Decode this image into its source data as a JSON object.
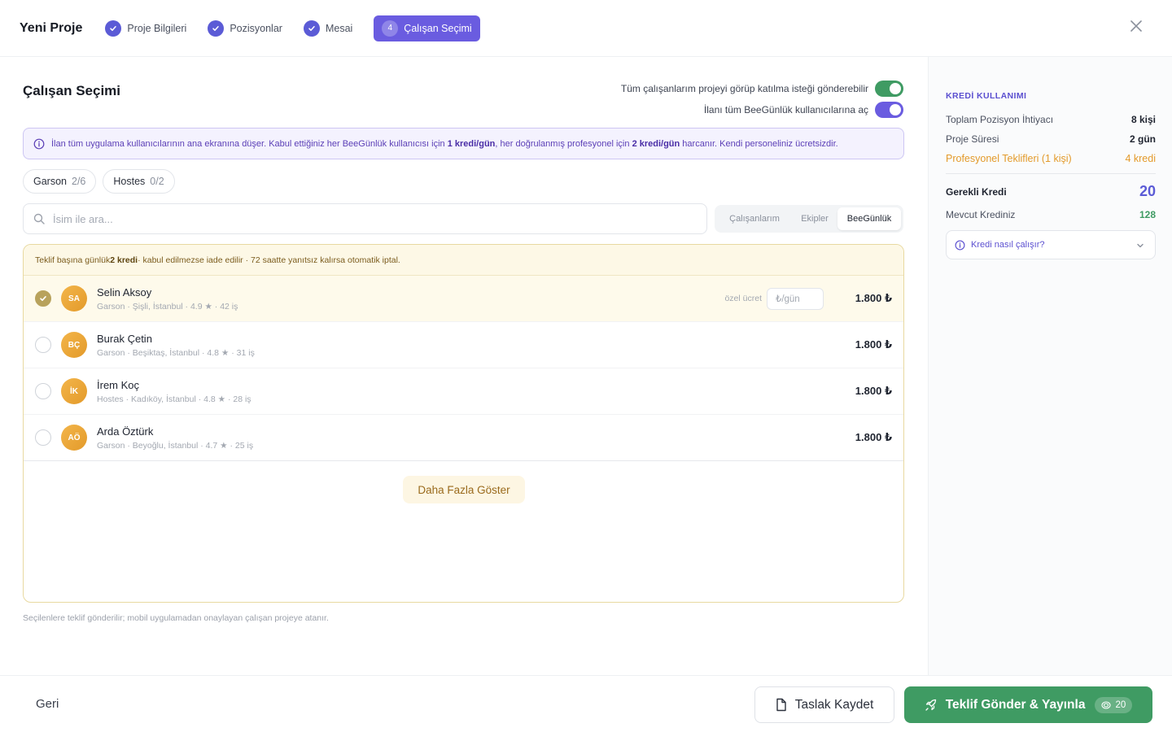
{
  "header": {
    "app_title": "Yeni Proje",
    "steps": [
      {
        "label": "Proje Bilgileri"
      },
      {
        "label": "Pozisyonlar"
      },
      {
        "label": "Mesai"
      }
    ],
    "active_step": {
      "num": "4",
      "label": "Çalışan Seçimi"
    }
  },
  "main": {
    "title": "Çalışan Seçimi",
    "toggles": [
      {
        "label": "Tüm çalışanlarım projeyi görüp katılma isteği gönderebilir",
        "on": true,
        "color": "#3f9b63"
      },
      {
        "label": "İlanı tüm BeeGünlük kullanıcılarına aç",
        "on": true,
        "color": "#6a5ce0"
      }
    ],
    "info": {
      "t1": "İlan tüm uygulama kullanıcılarının ana ekranına düşer. Kabul ettiğiniz her BeeGünlük kullanıcısı için ",
      "b1": "1 kredi/gün",
      "t2": ", her doğrulanmış profesyonel için ",
      "b2": "2 kredi/gün",
      "t3": " harcanır. Kendi personeliniz ücretsizdir."
    },
    "chips": [
      {
        "label": "Garson",
        "count": "2/6"
      },
      {
        "label": "Hostes",
        "count": "0/2"
      }
    ],
    "search_placeholder": "İsim ile ara...",
    "segments": [
      "Çalışanlarım",
      "Ekipler",
      "BeeGünlük"
    ],
    "active_segment": "BeeGünlük",
    "notice": {
      "t1": "Teklif başına günlük ",
      "b1": "2 kredi",
      "t2": " · kabul edilmezse iade edilir · 72 saatte yanıtsız kalırsa otomatik iptal."
    },
    "custom_price_label": "özel ücret",
    "custom_price_placeholder": "₺/gün",
    "employees": [
      {
        "initials": "SA",
        "name": "Selin Aksoy",
        "meta": "Garson · Şişli, İstanbul · 4.9 ★ · 42 iş",
        "price": "1.800 ₺",
        "selected": true
      },
      {
        "initials": "BÇ",
        "name": "Burak Çetin",
        "meta": "Garson · Beşiktaş, İstanbul · 4.8 ★ · 31 iş",
        "price": "1.800 ₺",
        "selected": false
      },
      {
        "initials": "İK",
        "name": "İrem Koç",
        "meta": "Hostes · Kadıköy, İstanbul · 4.8 ★ · 28 iş",
        "price": "1.800 ₺",
        "selected": false
      },
      {
        "initials": "AÖ",
        "name": "Arda Öztürk",
        "meta": "Garson · Beyoğlu, İstanbul · 4.7 ★ · 25 iş",
        "price": "1.800 ₺",
        "selected": false
      }
    ],
    "show_more": "Daha Fazla Göster",
    "footnote": "Seçilenlere teklif gönderilir; mobil uygulamadan onaylayan çalışan projeye atanır."
  },
  "sidebar": {
    "label": "KREDİ KULLANIMI",
    "total_label": "Toplam Pozisyon İhtiyacı",
    "total_value": "8 kişi",
    "duration_label": "Proje Süresi",
    "duration_value": "2 gün",
    "pro_label": "Profesyonel Teklifleri (1 kişi)",
    "pro_value": "4 kredi",
    "required_label": "Gerekli Kredi",
    "required_value": "20",
    "current_label": "Mevcut Krediniz",
    "current_value": "128",
    "howto": "Kredi nasıl çalışır?"
  },
  "footer": {
    "back": "Geri",
    "draft": "Taslak Kaydet",
    "publish": "Teklif Gönder & Yayınla",
    "publish_badge": "20"
  },
  "colors": {
    "accent": "#6a5ce0",
    "success": "#3f9b63",
    "warning": "#e39a2a"
  }
}
